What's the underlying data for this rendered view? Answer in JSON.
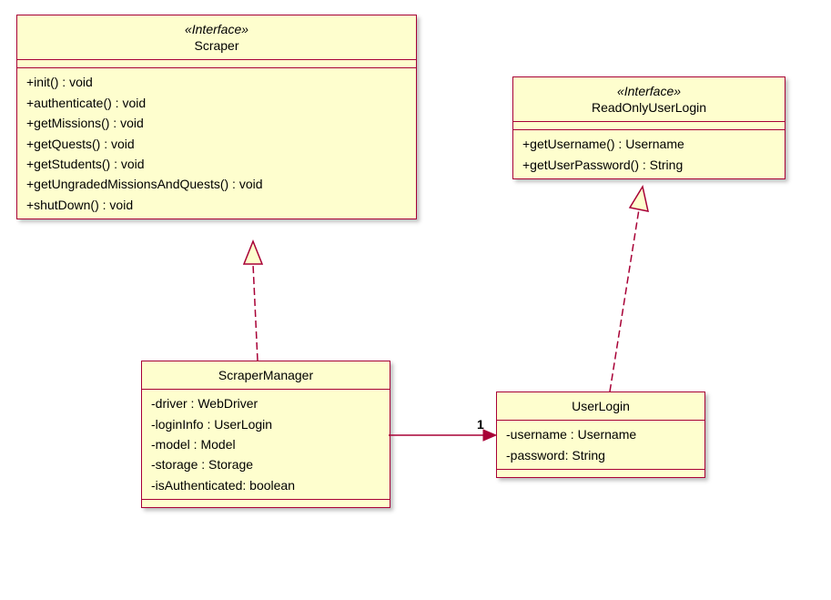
{
  "scraper": {
    "stereotype": "«Interface»",
    "name": "Scraper",
    "methods": [
      "+init() : void",
      "+authenticate() : void",
      "+getMissions() : void",
      "+getQuests() : void",
      "+getStudents() : void",
      "+getUngradedMissionsAndQuests() : void",
      "+shutDown() : void"
    ]
  },
  "readOnlyUserLogin": {
    "stereotype": "«Interface»",
    "name": "ReadOnlyUserLogin",
    "methods": [
      "+getUsername() : Username",
      "+getUserPassword() : String"
    ]
  },
  "scraperManager": {
    "name": "ScraperManager",
    "attributes": [
      "-driver : WebDriver",
      "-loginInfo : UserLogin",
      "-model : Model",
      "-storage : Storage",
      "-isAuthenticated: boolean"
    ]
  },
  "userLogin": {
    "name": "UserLogin",
    "attributes": [
      "-username : Username",
      "-password: String"
    ]
  },
  "association": {
    "multiplicity": "1"
  }
}
